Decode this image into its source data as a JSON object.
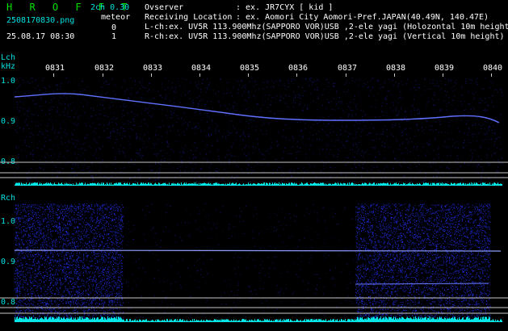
{
  "header": {
    "app_title": "H R O F F T",
    "channel_label": "2ch 0.30",
    "filename": "2508170830.png",
    "meteor_label": "meteor",
    "date_time": "25.08.17 08:30",
    "count_l": "0",
    "count_r": "1",
    "observer_key": "Ovserver",
    "observer_value": ": ex. JR7CYX [ kid ]",
    "location_key": "Receiving Location",
    "location_value": ": ex. Aomori City Aomori-Pref.JAPAN(40.49N, 140.47E)",
    "lch_info": "L-ch:ex. UV5R 113.900Mhz(SAPPORO VOR)USB ,2-ele yagi (Holozontal 10m height)",
    "rch_info": "R-ch:ex. UV5R 113.900Mhz(SAPPORO VOR)USB ,2-ele yagi (Vertical 10m height)"
  },
  "axis": {
    "time_ticks": [
      "0831",
      "0832",
      "0833",
      "0834",
      "0835",
      "0836",
      "0837",
      "0838",
      "0839",
      "0840"
    ],
    "lch_label": "Lch",
    "khz_label": "kHz",
    "rch_label": "Rch",
    "freq_ticks": [
      "1.0",
      "0.9",
      "0.8"
    ]
  },
  "colors": {
    "background": "#000000",
    "title_green": "#00e000",
    "label_cyan": "#00e0e0",
    "spectrum_blue": "#3a3aff",
    "trace_blue": "#5a6cff",
    "ref_line": "#c8c8c8",
    "level_cyan": "#00e8e8"
  }
}
